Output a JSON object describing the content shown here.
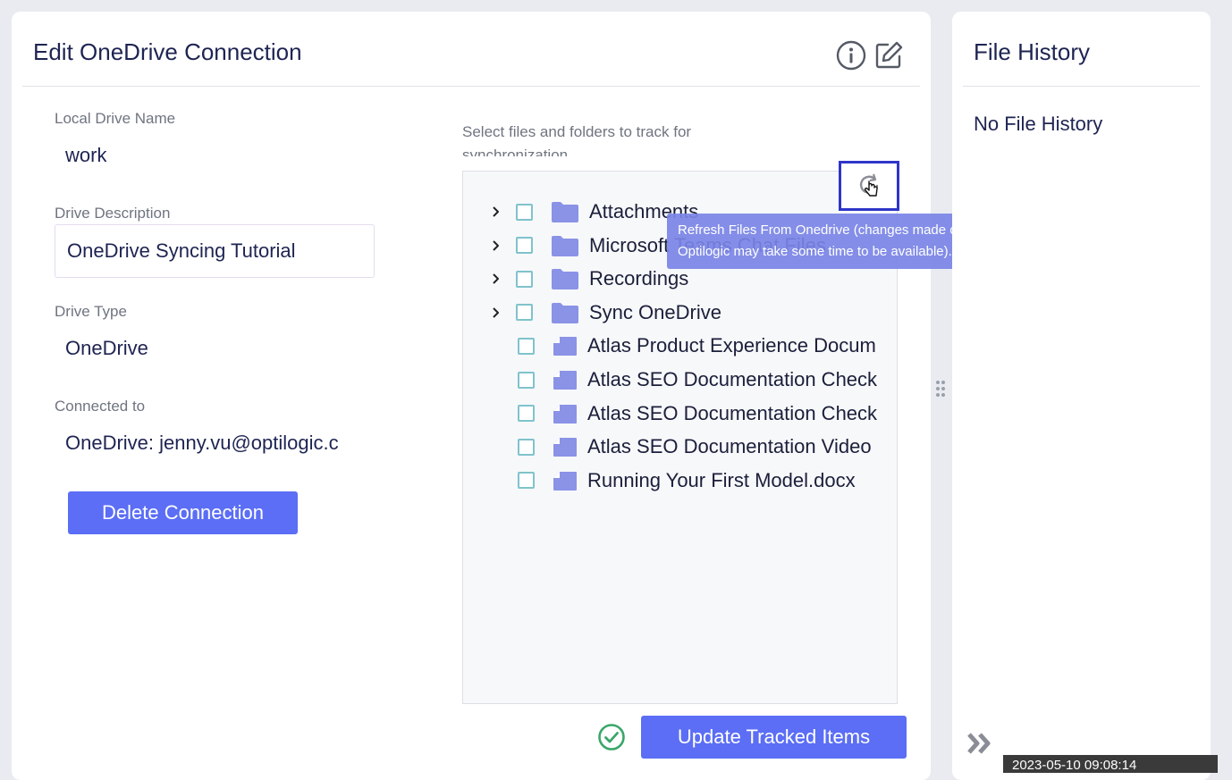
{
  "edit_panel": {
    "title": "Edit OneDrive Connection",
    "info_icon": "info-circle-icon",
    "edit_icon": "edit-note-icon",
    "fields": {
      "local_drive_name_label": "Local Drive Name",
      "local_drive_name_value": "work",
      "drive_description_label": "Drive Description",
      "drive_description_value": "OneDrive Syncing Tutorial",
      "drive_type_label": "Drive Type",
      "drive_type_value": "OneDrive",
      "connected_to_label": "Connected to",
      "connected_to_value": "OneDrive: jenny.vu@optilogic.c"
    },
    "delete_button_label": "Delete Connection",
    "select_hint": "Select files and folders to track for synchronization",
    "tree_items": [
      {
        "label": "Attachments",
        "type": "folder",
        "expandable": true
      },
      {
        "label": "Microsoft Teams Chat Files",
        "type": "folder",
        "expandable": true
      },
      {
        "label": "Recordings",
        "type": "folder",
        "expandable": true
      },
      {
        "label": "Sync OneDrive",
        "type": "folder",
        "expandable": true
      },
      {
        "label": "Atlas Product Experience Docum",
        "type": "file",
        "expandable": false
      },
      {
        "label": "Atlas SEO Documentation Check",
        "type": "file",
        "expandable": false
      },
      {
        "label": "Atlas SEO Documentation Check",
        "type": "file",
        "expandable": false
      },
      {
        "label": "Atlas SEO Documentation Video",
        "type": "file",
        "expandable": false
      },
      {
        "label": "Running Your First Model.docx",
        "type": "file",
        "expandable": false
      }
    ],
    "refresh_tooltip": "Refresh Files From Onedrive (changes made outside of Optilogic may take some time to be available).",
    "update_button_label": "Update Tracked Items"
  },
  "history_panel": {
    "title": "File History",
    "empty_text": "No File History"
  },
  "timestamp": "2023-05-10 09:08:14",
  "colors": {
    "accent": "#5b6ef5",
    "folder": "#8a93e6",
    "checkbox_border": "#7fc3cc",
    "success": "#3aa66a",
    "highlight": "#2f35c9"
  }
}
